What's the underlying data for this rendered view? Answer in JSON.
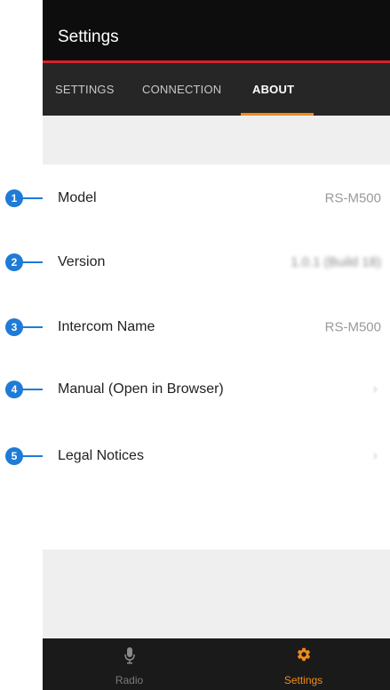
{
  "header": {
    "title": "Settings"
  },
  "tabs": [
    {
      "label": "SETTINGS",
      "active": false
    },
    {
      "label": "CONNECTION",
      "active": false
    },
    {
      "label": "ABOUT",
      "active": true
    }
  ],
  "about": {
    "rows": [
      {
        "label": "Model",
        "value": "RS-M500"
      },
      {
        "label": "Version",
        "value": "1.0.1 (Build 18)"
      },
      {
        "label": "Intercom Name",
        "value": "RS-M500"
      },
      {
        "label": "Manual (Open in Browser)",
        "chevron": "›"
      },
      {
        "label": "Legal Notices",
        "chevron": "›"
      }
    ]
  },
  "callouts": [
    "1",
    "2",
    "3",
    "4",
    "5"
  ],
  "bottom_nav": {
    "items": [
      {
        "label": "Radio",
        "icon": "microphone-icon",
        "active": false
      },
      {
        "label": "Settings",
        "icon": "gear-icon",
        "active": true
      }
    ]
  },
  "colors": {
    "accent_red": "#d8232a",
    "accent_orange": "#f08c1b",
    "callout_blue": "#1f7bd6",
    "appbar_bg": "#0d0d0d",
    "tabbar_bg": "#262626"
  }
}
